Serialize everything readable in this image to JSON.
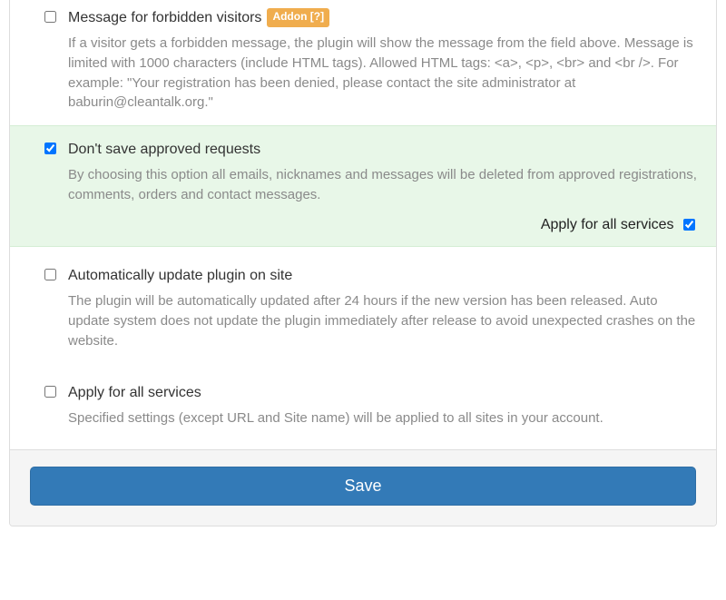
{
  "settings": {
    "message_forbidden": {
      "title": "Message for forbidden visitors",
      "badge": "Addon [?]",
      "desc": "If a visitor gets a forbidden message, the plugin will show the message from the field above. Message is limited with 1000 characters (include HTML tags). Allowed HTML tags: <a>, <p>, <br> and <br />. For example: \"Your registration has been denied, please contact the site administrator at baburin@cleantalk.org.\"",
      "checked": false
    },
    "dont_save_approved": {
      "title": "Don't save approved requests",
      "desc": "By choosing this option all emails, nicknames and messages will be deleted from approved registrations, comments, orders and contact messages.",
      "checked": true,
      "apply_all_label": "Apply for all services",
      "apply_all_checked": true
    },
    "auto_update": {
      "title": "Automatically update plugin on site",
      "desc": "The plugin will be automatically updated after 24 hours if the new version has been released. Auto update system does not update the plugin immediately after release to avoid unexpected crashes on the website.",
      "checked": false
    },
    "apply_all_services": {
      "title": "Apply for all services",
      "desc": "Specified settings (except URL and Site name) will be applied to all sites in your account.",
      "checked": false
    }
  },
  "footer": {
    "save_label": "Save"
  }
}
